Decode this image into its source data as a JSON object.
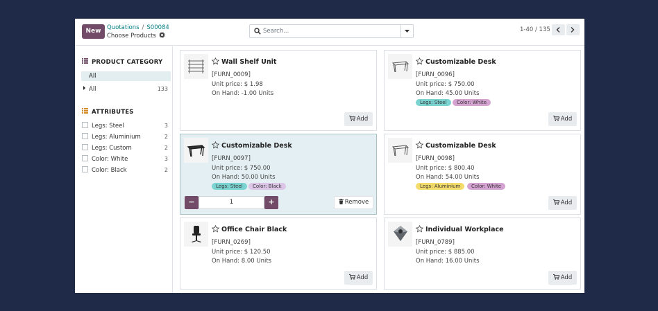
{
  "header": {
    "new_label": "New",
    "breadcrumb_parent": "Quotations",
    "breadcrumb_sep": "/",
    "breadcrumb_record": "S00084",
    "subtitle": "Choose Products",
    "search_placeholder": "Search...",
    "pager": "1-40 / 135"
  },
  "sidebar": {
    "category_title": "PRODUCT CATEGORY",
    "category_selected": "All",
    "category_row": {
      "label": "All",
      "count": "133"
    },
    "attributes_title": "ATTRIBUTES",
    "attributes": [
      {
        "label": "Legs: Steel",
        "count": "3"
      },
      {
        "label": "Legs: Aluminium",
        "count": "2"
      },
      {
        "label": "Legs: Custom",
        "count": "2"
      },
      {
        "label": "Color: White",
        "count": "3"
      },
      {
        "label": "Color: Black",
        "count": "2"
      }
    ]
  },
  "products": [
    {
      "name": "Wall Shelf Unit",
      "ref": "[FURN_0009]",
      "price": "Unit price: $ 1.98",
      "onhand": "On Hand: -1.00 Units",
      "action": "Add"
    },
    {
      "name": "Customizable Desk",
      "ref": "[FURN_0096]",
      "price": "Unit price: $ 750.00",
      "onhand": "On Hand: 45.00 Units",
      "tags": [
        "Legs: Steel",
        "Color: White"
      ],
      "action": "Add"
    },
    {
      "name": "Customizable Desk",
      "ref": "[FURN_0097]",
      "price": "Unit price: $ 750.00",
      "onhand": "On Hand: 50.00 Units",
      "tags": [
        "Legs: Steel",
        "Color: Black"
      ],
      "quantity": "1",
      "minus": "−",
      "plus": "+",
      "action": "Remove"
    },
    {
      "name": "Customizable Desk",
      "ref": "[FURN_0098]",
      "price": "Unit price: $ 800.40",
      "onhand": "On Hand: 54.00 Units",
      "tags": [
        "Legs: Aluminium",
        "Color: White"
      ],
      "action": "Add"
    },
    {
      "name": "Office Chair Black",
      "ref": "[FURN_0269]",
      "price": "Unit price: $ 120.50",
      "onhand": "On Hand: 8.00 Units",
      "action": "Add"
    },
    {
      "name": "Individual Workplace",
      "ref": "[FURN_0789]",
      "price": "Unit price: $ 885.00",
      "onhand": "On Hand: 16.00 Units",
      "action": "Add"
    }
  ],
  "colors": {
    "primary": "#714b67",
    "link": "#017e84",
    "selected_card_bg": "#e3eff2",
    "page_bg": "#1f2a48"
  },
  "icons": {
    "search": "search-icon",
    "gear": "gear-icon",
    "star": "star-outline-icon",
    "cart": "cart-icon",
    "trash": "trash-icon",
    "caret": "caret-right-icon"
  }
}
